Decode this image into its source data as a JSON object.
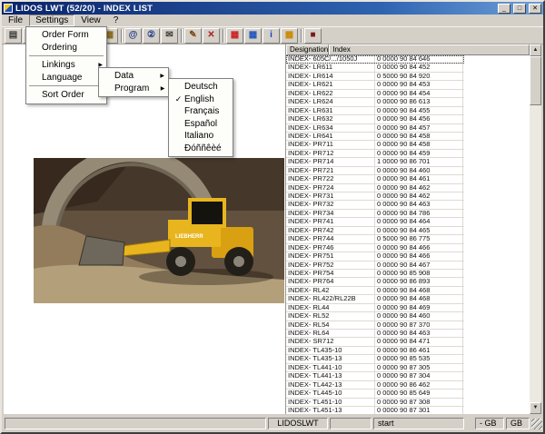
{
  "window": {
    "title": "LIDOS LWT (52/20) - INDEX LIST",
    "controls": {
      "minimize": "_",
      "maximize": "□",
      "close": "✕"
    }
  },
  "icons": {
    "check": "✓",
    "submenu_arrow": "▶",
    "scroll_up": "▲",
    "scroll_down": "▼"
  },
  "menubar": {
    "items": [
      {
        "name": "menu-file",
        "label": "File"
      },
      {
        "name": "menu-settings",
        "label": "Settings",
        "open": true
      },
      {
        "name": "menu-view",
        "label": "View"
      },
      {
        "name": "menu-help",
        "label": "?"
      }
    ]
  },
  "menus": {
    "settings": {
      "items": [
        {
          "name": "menu-item-order-form",
          "label": "Order Form"
        },
        {
          "name": "menu-item-ordering",
          "label": "Ordering"
        },
        {
          "sep": true
        },
        {
          "name": "menu-item-linkings",
          "label": "Linkings",
          "arrow": true
        },
        {
          "name": "menu-item-language",
          "label": "Language",
          "arrow": true
        },
        {
          "sep": true
        },
        {
          "name": "menu-item-sort-order",
          "label": "Sort Order",
          "arrow": true
        }
      ]
    },
    "language": {
      "items": [
        {
          "name": "menu-item-data",
          "label": "Data",
          "arrow": true
        },
        {
          "name": "menu-item-program",
          "label": "Program",
          "arrow": true
        }
      ]
    },
    "program": {
      "items": [
        {
          "name": "menu-item-deutsch",
          "label": "Deutsch"
        },
        {
          "name": "menu-item-english",
          "label": "English",
          "checked": true
        },
        {
          "name": "menu-item-francais",
          "label": "Français"
        },
        {
          "name": "menu-item-espanol",
          "label": "Español"
        },
        {
          "name": "menu-item-italiano",
          "label": "Italiano"
        },
        {
          "name": "menu-item-russian",
          "label": "Ðóññêèé"
        }
      ]
    }
  },
  "toolbar": {
    "items": [
      {
        "name": "document-button",
        "glyph": "▤",
        "color": "#3a3a3a"
      },
      {
        "name": "nav-prev-button",
        "glyph": "◀",
        "color": "#3a3a3a"
      },
      {
        "name": "nav-next-button",
        "glyph": "▶",
        "color": "#3a3a3a"
      },
      {
        "sep": true
      },
      {
        "name": "pages-button",
        "glyph": "▣",
        "color": "#3a3a3a"
      },
      {
        "name": "copy-button",
        "glyph": "▥",
        "color": "#3a3a3a"
      },
      {
        "name": "folder-button",
        "glyph": "▦",
        "color": "#8a6a1a"
      },
      {
        "sep": true
      },
      {
        "name": "search-a-button",
        "glyph": "@",
        "color": "#1a3a8a"
      },
      {
        "name": "search-2-button",
        "glyph": "②",
        "color": "#1a3a8a"
      },
      {
        "name": "mail-button",
        "glyph": "✉",
        "color": "#3a3a3a"
      },
      {
        "sep": true
      },
      {
        "name": "edit-button",
        "glyph": "✎",
        "color": "#7a4a10"
      },
      {
        "name": "delete-button",
        "glyph": "✕",
        "color": "#aa2222"
      },
      {
        "sep": true
      },
      {
        "name": "partlist-red-button",
        "glyph": "▦",
        "color": "#cc2222"
      },
      {
        "name": "partlist-multi-button",
        "glyph": "▦",
        "color": "#2255bb"
      },
      {
        "name": "info-button",
        "glyph": "i",
        "color": "#1144cc"
      },
      {
        "name": "partlist-yellow-button",
        "glyph": "▦",
        "color": "#cc8800"
      },
      {
        "sep": true
      },
      {
        "name": "stop-button",
        "glyph": "■",
        "color": "#7a1a1a"
      }
    ]
  },
  "photo": {
    "brand": "LIEBHERR"
  },
  "table": {
    "columns": [
      "Designation",
      "Index"
    ],
    "rows": [
      {
        "focused": true,
        "designation": "INDEX- 605C/.../1050J",
        "index": "0 0000 90 84 646"
      },
      {
        "designation": "INDEX- LR611",
        "index": "0 0000 90 84 452"
      },
      {
        "designation": "INDEX- LR614",
        "index": "0 5000 90 84 920"
      },
      {
        "designation": "INDEX- LR621",
        "index": "0 0000 90 84 453"
      },
      {
        "designation": "INDEX- LR622",
        "index": "0 0000 90 84 454"
      },
      {
        "designation": "INDEX- LR624",
        "index": "0 0000 90 86 613"
      },
      {
        "designation": "INDEX- LR631",
        "index": "0 0000 90 84 455"
      },
      {
        "designation": "INDEX- LR632",
        "index": "0 0000 90 84 456"
      },
      {
        "designation": "INDEX- LR634",
        "index": "0 0000 90 84 457"
      },
      {
        "designation": "INDEX- LR641",
        "index": "0 0000 90 84 458"
      },
      {
        "designation": "INDEX- PR711",
        "index": "0 0000 90 84 458"
      },
      {
        "designation": "INDEX- PR712",
        "index": "0 0000 90 84 459"
      },
      {
        "designation": "INDEX- PR714",
        "index": "1 0000 90 86 701"
      },
      {
        "designation": "INDEX- PR721",
        "index": "0 0000 90 84 460"
      },
      {
        "designation": "INDEX- PR722",
        "index": "0 0000 90 84 461"
      },
      {
        "designation": "INDEX- PR724",
        "index": "0 0000 90 84 462"
      },
      {
        "designation": "INDEX- PR731",
        "index": "0 0000 90 84 462"
      },
      {
        "designation": "INDEX- PR732",
        "index": "0 0000 90 84 463"
      },
      {
        "designation": "INDEX- PR734",
        "index": "0 0000 90 84 786"
      },
      {
        "designation": "INDEX- PR741",
        "index": "0 0000 90 84 464"
      },
      {
        "designation": "INDEX- PR742",
        "index": "0 0000 90 84 465"
      },
      {
        "designation": "INDEX- PR744",
        "index": "0 5000 90 86 775"
      },
      {
        "designation": "INDEX- PR746",
        "index": "0 0000 90 84 466"
      },
      {
        "designation": "INDEX- PR751",
        "index": "0 0000 90 84 466"
      },
      {
        "designation": "INDEX- PR752",
        "index": "0 0000 90 84 467"
      },
      {
        "designation": "INDEX- PR754",
        "index": "0 0000 90 85 908"
      },
      {
        "designation": "INDEX- PR764",
        "index": "0 0000 90 86 893"
      },
      {
        "designation": "INDEX- RL42",
        "index": "0 0000 90 84 468"
      },
      {
        "designation": "INDEX- RL422/RL22B",
        "index": "0 0000 90 84 468"
      },
      {
        "designation": "INDEX- RL44",
        "index": "0 0000 90 84 469"
      },
      {
        "designation": "INDEX- RL52",
        "index": "0 0000 90 84 460"
      },
      {
        "designation": "INDEX- RL54",
        "index": "0 0000 90 87 370"
      },
      {
        "designation": "INDEX- RL64",
        "index": "0 0000 90 84 463"
      },
      {
        "designation": "INDEX- SR712",
        "index": "0 0000 90 84 471"
      },
      {
        "designation": "INDEX- TL435-10",
        "index": "0 0000 90 86 461"
      },
      {
        "designation": "INDEX- TL435-13",
        "index": "0 0000 90 85 535"
      },
      {
        "designation": "INDEX- TL441-10",
        "index": "0 0000 90 87 305"
      },
      {
        "designation": "INDEX- TL441-13",
        "index": "0 0000 90 87 304"
      },
      {
        "designation": "INDEX- TL442-13",
        "index": "0 0000 90 86 462"
      },
      {
        "designation": "INDEX- TL445-10",
        "index": "0 0000 90 85 649"
      },
      {
        "designation": "INDEX- TL451-10",
        "index": "0 0000 90 87 308"
      },
      {
        "designation": "INDEX- TL451-13",
        "index": "0 0000 90 87 301"
      }
    ]
  },
  "statusbar": {
    "app": "LIDOSLWT",
    "action": "start",
    "lang1": "- GB",
    "lang2": "GB"
  }
}
